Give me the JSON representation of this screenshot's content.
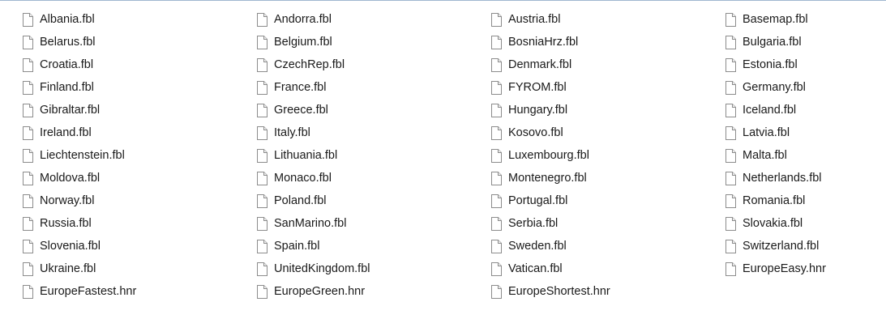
{
  "files": [
    {
      "name": "Albania.fbl",
      "icon": "document-icon"
    },
    {
      "name": "Andorra.fbl",
      "icon": "document-icon"
    },
    {
      "name": "Austria.fbl",
      "icon": "document-icon"
    },
    {
      "name": "Basemap.fbl",
      "icon": "document-icon"
    },
    {
      "name": "Belarus.fbl",
      "icon": "document-icon"
    },
    {
      "name": "Belgium.fbl",
      "icon": "document-icon"
    },
    {
      "name": "BosniaHrz.fbl",
      "icon": "document-icon"
    },
    {
      "name": "Bulgaria.fbl",
      "icon": "document-icon"
    },
    {
      "name": "Croatia.fbl",
      "icon": "document-icon"
    },
    {
      "name": "CzechRep.fbl",
      "icon": "document-icon"
    },
    {
      "name": "Denmark.fbl",
      "icon": "document-icon"
    },
    {
      "name": "Estonia.fbl",
      "icon": "document-icon"
    },
    {
      "name": "Finland.fbl",
      "icon": "document-icon"
    },
    {
      "name": "France.fbl",
      "icon": "document-icon"
    },
    {
      "name": "FYROM.fbl",
      "icon": "document-icon"
    },
    {
      "name": "Germany.fbl",
      "icon": "document-icon"
    },
    {
      "name": "Gibraltar.fbl",
      "icon": "document-icon"
    },
    {
      "name": "Greece.fbl",
      "icon": "document-icon"
    },
    {
      "name": "Hungary.fbl",
      "icon": "document-icon"
    },
    {
      "name": "Iceland.fbl",
      "icon": "document-icon"
    },
    {
      "name": "Ireland.fbl",
      "icon": "document-icon"
    },
    {
      "name": "Italy.fbl",
      "icon": "document-icon"
    },
    {
      "name": "Kosovo.fbl",
      "icon": "document-icon"
    },
    {
      "name": "Latvia.fbl",
      "icon": "document-icon"
    },
    {
      "name": "Liechtenstein.fbl",
      "icon": "document-icon"
    },
    {
      "name": "Lithuania.fbl",
      "icon": "document-icon"
    },
    {
      "name": "Luxembourg.fbl",
      "icon": "document-icon"
    },
    {
      "name": "Malta.fbl",
      "icon": "document-icon"
    },
    {
      "name": "Moldova.fbl",
      "icon": "document-icon"
    },
    {
      "name": "Monaco.fbl",
      "icon": "document-icon"
    },
    {
      "name": "Montenegro.fbl",
      "icon": "document-icon"
    },
    {
      "name": "Netherlands.fbl",
      "icon": "document-icon"
    },
    {
      "name": "Norway.fbl",
      "icon": "document-icon"
    },
    {
      "name": "Poland.fbl",
      "icon": "document-icon"
    },
    {
      "name": "Portugal.fbl",
      "icon": "document-icon"
    },
    {
      "name": "Romania.fbl",
      "icon": "document-icon"
    },
    {
      "name": "Russia.fbl",
      "icon": "document-icon"
    },
    {
      "name": "SanMarino.fbl",
      "icon": "document-icon"
    },
    {
      "name": "Serbia.fbl",
      "icon": "document-icon"
    },
    {
      "name": "Slovakia.fbl",
      "icon": "document-icon"
    },
    {
      "name": "Slovenia.fbl",
      "icon": "document-icon"
    },
    {
      "name": "Spain.fbl",
      "icon": "document-icon"
    },
    {
      "name": "Sweden.fbl",
      "icon": "document-icon"
    },
    {
      "name": "Switzerland.fbl",
      "icon": "document-icon"
    },
    {
      "name": "Ukraine.fbl",
      "icon": "document-icon"
    },
    {
      "name": "UnitedKingdom.fbl",
      "icon": "document-icon"
    },
    {
      "name": "Vatican.fbl",
      "icon": "document-icon"
    },
    {
      "name": "EuropeEasy.hnr",
      "icon": "document-icon"
    },
    {
      "name": "EuropeFastest.hnr",
      "icon": "document-icon"
    },
    {
      "name": "EuropeGreen.hnr",
      "icon": "document-icon"
    },
    {
      "name": "EuropeShortest.hnr",
      "icon": "document-icon"
    }
  ],
  "colors": {
    "text": "#1a1a1a",
    "background": "#ffffff",
    "top_border": "#9fb6cf",
    "icon_outline": "#8c8c8c"
  }
}
